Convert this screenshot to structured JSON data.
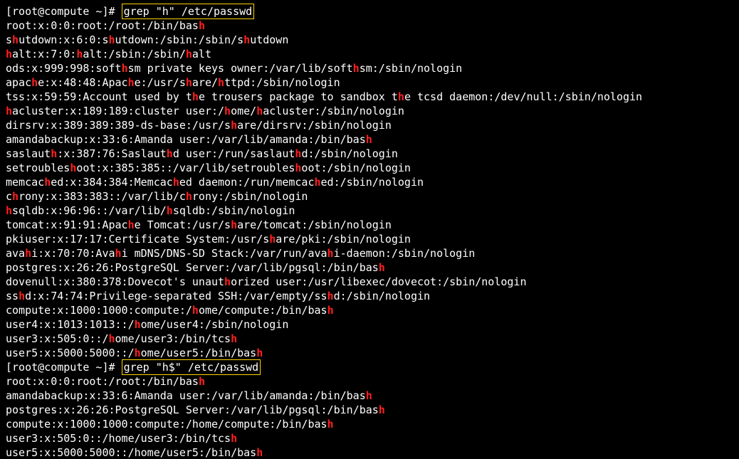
{
  "prompt": "[root@compute ~]# ",
  "commands": {
    "cmd1": "grep \"h\" /etc/passwd",
    "cmd2": "grep \"h$\" /etc/passwd"
  },
  "output1": [
    "root:x:0:0:root:/root:/bin/bash",
    "shutdown:x:6:0:shutdown:/sbin:/sbin/shutdown",
    "halt:x:7:0:halt:/sbin:/sbin/halt",
    "ods:x:999:998:softhsm private keys owner:/var/lib/softhsm:/sbin/nologin",
    "apache:x:48:48:Apache:/usr/share/httpd:/sbin/nologin",
    "tss:x:59:59:Account used by the trousers package to sandbox the tcsd daemon:/dev/null:/sbin/nologin",
    "hacluster:x:189:189:cluster user:/home/hacluster:/sbin/nologin",
    "dirsrv:x:389:389:389-ds-base:/usr/share/dirsrv:/sbin/nologin",
    "amandabackup:x:33:6:Amanda user:/var/lib/amanda:/bin/bash",
    "saslauth:x:387:76:Saslauthd user:/run/saslauthd:/sbin/nologin",
    "setroubleshoot:x:385:385::/var/lib/setroubleshoot:/sbin/nologin",
    "memcached:x:384:384:Memcached daemon:/run/memcached:/sbin/nologin",
    "chrony:x:383:383::/var/lib/chrony:/sbin/nologin",
    "hsqldb:x:96:96::/var/lib/hsqldb:/sbin/nologin",
    "tomcat:x:91:91:Apache Tomcat:/usr/share/tomcat:/sbin/nologin",
    "pkiuser:x:17:17:Certificate System:/usr/share/pki:/sbin/nologin",
    "avahi:x:70:70:Avahi mDNS/DNS-SD Stack:/var/run/avahi-daemon:/sbin/nologin",
    "postgres:x:26:26:PostgreSQL Server:/var/lib/pgsql:/bin/bash",
    "dovenull:x:380:378:Dovecot's unauthorized user:/usr/libexec/dovecot:/sbin/nologin",
    "sshd:x:74:74:Privilege-separated SSH:/var/empty/sshd:/sbin/nologin",
    "compute:x:1000:1000:compute:/home/compute:/bin/bash",
    "user4:x:1013:1013::/home/user4:/sbin/nologin",
    "user3:x:505:0::/home/user3:/bin/tcsh",
    "user5:x:5000:5000::/home/user5:/bin/bash"
  ],
  "output2": [
    "root:x:0:0:root:/root:/bin/bash",
    "amandabackup:x:33:6:Amanda user:/var/lib/amanda:/bin/bash",
    "postgres:x:26:26:PostgreSQL Server:/var/lib/pgsql:/bin/bash",
    "compute:x:1000:1000:compute:/home/compute:/bin/bash",
    "user3:x:505:0::/home/user3:/bin/tcsh",
    "user5:x:5000:5000::/home/user5:/bin/bash"
  ],
  "highlight1": "h",
  "highlight2_regex": "h$"
}
